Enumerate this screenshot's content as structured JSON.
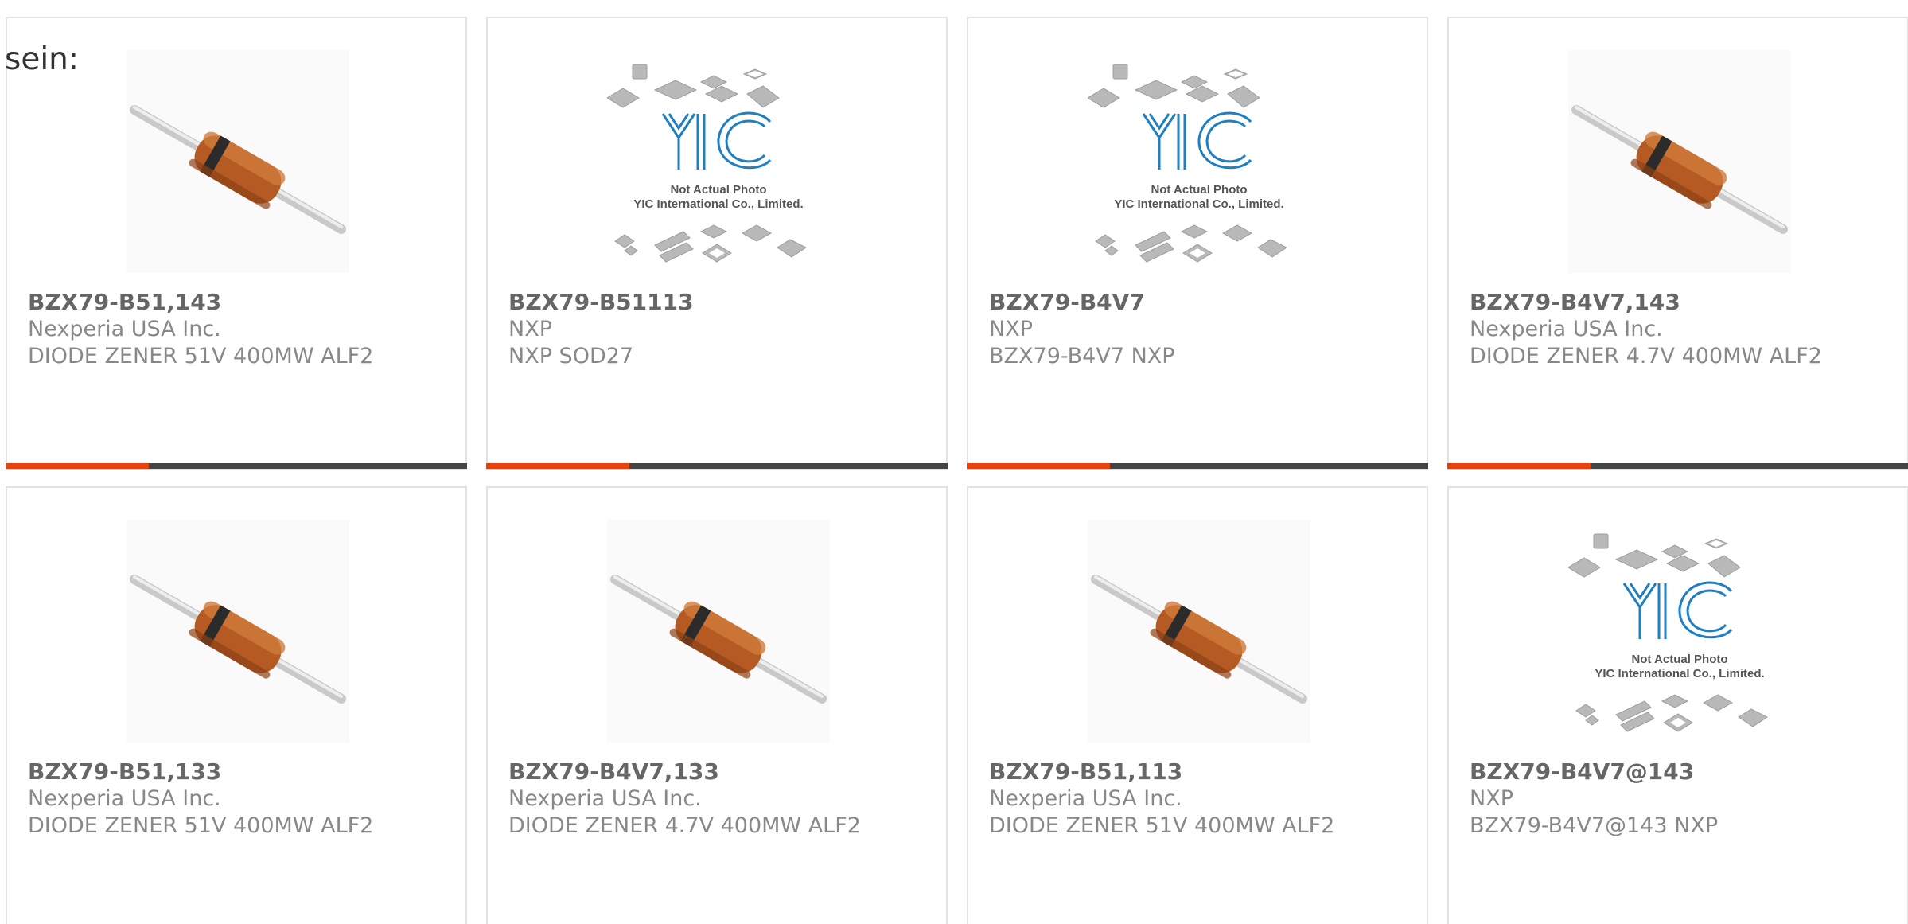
{
  "intro_text": "sein:",
  "colors": {
    "accent": "#e8410a",
    "bar_track": "#444444",
    "border": "#e2e2e2"
  },
  "cards": [
    {
      "part": "BZX79-B51,143",
      "maker": "Nexperia USA Inc.",
      "desc": "DIODE ZENER 51V 400MW ALF2",
      "image": "diode-photo",
      "bar_fraction": 0.31
    },
    {
      "part": "BZX79-B51113",
      "maker": "NXP",
      "desc": "NXP SOD27",
      "image": "placeholder-photo",
      "bar_fraction": 0.31
    },
    {
      "part": "BZX79-B4V7",
      "maker": "NXP",
      "desc": "BZX79-B4V7 NXP",
      "image": "placeholder-photo",
      "bar_fraction": 0.31
    },
    {
      "part": "BZX79-B4V7,143",
      "maker": "Nexperia USA Inc.",
      "desc": "DIODE ZENER 4.7V 400MW ALF2",
      "image": "diode-photo",
      "bar_fraction": 0.31
    },
    {
      "part": "BZX79-B51,133",
      "maker": "Nexperia USA Inc.",
      "desc": "DIODE ZENER 51V 400MW ALF2",
      "image": "diode-photo",
      "bar_fraction": 0
    },
    {
      "part": "BZX79-B4V7,133",
      "maker": "Nexperia USA Inc.",
      "desc": "DIODE ZENER 4.7V 400MW ALF2",
      "image": "diode-photo",
      "bar_fraction": 0
    },
    {
      "part": "BZX79-B51,113",
      "maker": "Nexperia USA Inc.",
      "desc": "DIODE ZENER 51V 400MW ALF2",
      "image": "diode-photo",
      "bar_fraction": 0
    },
    {
      "part": "BZX79-B4V7@143",
      "maker": "NXP",
      "desc": "BZX79-B4V7@143 NXP",
      "image": "placeholder-photo",
      "bar_fraction": 0
    }
  ],
  "placeholder": {
    "logo": "YIC",
    "line1": "Not Actual Photo",
    "line2": "YIC International Co., Limited."
  }
}
